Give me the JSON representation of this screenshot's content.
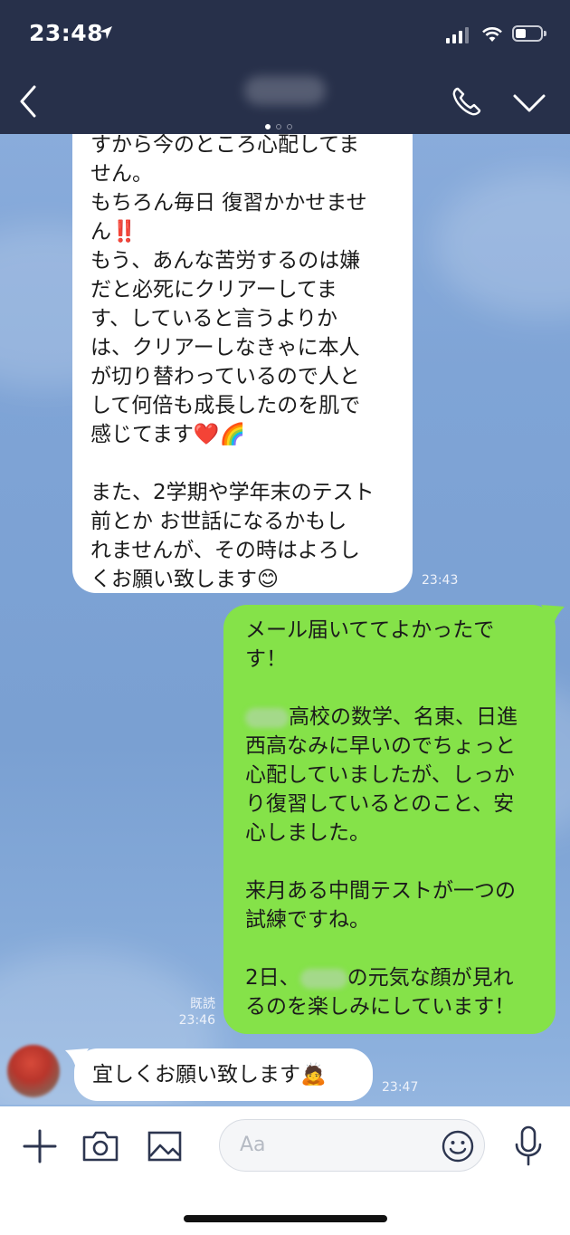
{
  "status_bar": {
    "time": "23:48"
  },
  "chat": {
    "incoming_1": {
      "lines": [
        "すから今のところ心配してま",
        "せん。",
        "もちろん毎日 復習かかせませ",
        "ん‼️",
        "もう、あんな苦労するのは嫌",
        "だと必死にクリアーしてま",
        "す、していると言うよりか",
        "は、クリアーしなきゃに本人",
        "が切り替わっているので人と",
        "して何倍も成長したのを肌で",
        "感じてます❤️🌈",
        "",
        "また、2学期や学年末のテスト",
        "前とか お世話になるかもし",
        "れませんが、その時はよろし",
        "くお願い致します😊"
      ],
      "time": "23:43"
    },
    "outgoing_1": {
      "lines": [
        "メール届いててよかったで",
        "す！",
        "",
        "高校の数学、名東、日進",
        "西高なみに早いのでちょっと",
        "心配していましたが、しっか",
        "り復習しているとのこと、安",
        "心しました。",
        "",
        "来月ある中間テストが一つの",
        "試練ですね。",
        "",
        "2日、",
        "るのを楽しみにしています！"
      ],
      "line4_prefix_blur": true,
      "line13_suffix": "の元気な顔が見れ",
      "read_label": "既読",
      "time": "23:46"
    },
    "incoming_2": {
      "text": "宜しくお願い致します🙇",
      "time": "23:47"
    }
  },
  "composer": {
    "placeholder": "Aa"
  },
  "colors": {
    "header_bg": "#27304a",
    "outgoing_bubble": "#85e249",
    "incoming_bubble": "#ffffff"
  }
}
